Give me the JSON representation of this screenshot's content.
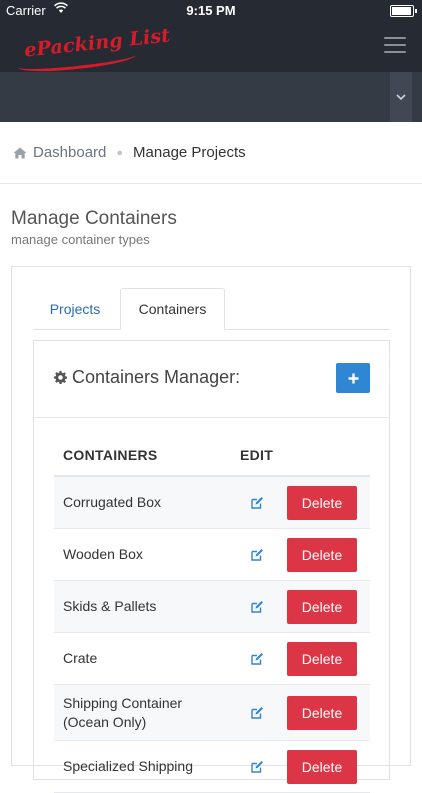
{
  "status_bar": {
    "carrier": "Carrier",
    "time": "9:15 PM"
  },
  "navbar": {
    "logo_text": "Packing List",
    "logo_prefix": "e"
  },
  "breadcrumb": {
    "home": "Dashboard",
    "current": "Manage Projects"
  },
  "page": {
    "title": "Manage Containers",
    "subtitle": "manage container types"
  },
  "tabs": [
    {
      "label": "Projects",
      "active": false
    },
    {
      "label": "Containers",
      "active": true
    }
  ],
  "manager": {
    "title": "Containers Manager:",
    "add_label": "+"
  },
  "table": {
    "headers": {
      "name": "CONTAINERS",
      "edit": "EDIT"
    },
    "rows": [
      {
        "name": "Corrugated Box",
        "action": "Delete"
      },
      {
        "name": "Wooden Box",
        "action": "Delete"
      },
      {
        "name": "Skids & Pallets",
        "action": "Delete"
      },
      {
        "name": "Crate",
        "action": "Delete"
      },
      {
        "name": "Shipping Container (Ocean Only)",
        "action": "Delete"
      },
      {
        "name": "Specialized Shipping",
        "action": "Delete"
      }
    ]
  },
  "colors": {
    "navbar": "#262b33",
    "subbar": "#353b45",
    "link": "#2a6db4",
    "primary": "#2f86d2",
    "danger": "#dc3545",
    "logo": "#d81b28"
  }
}
